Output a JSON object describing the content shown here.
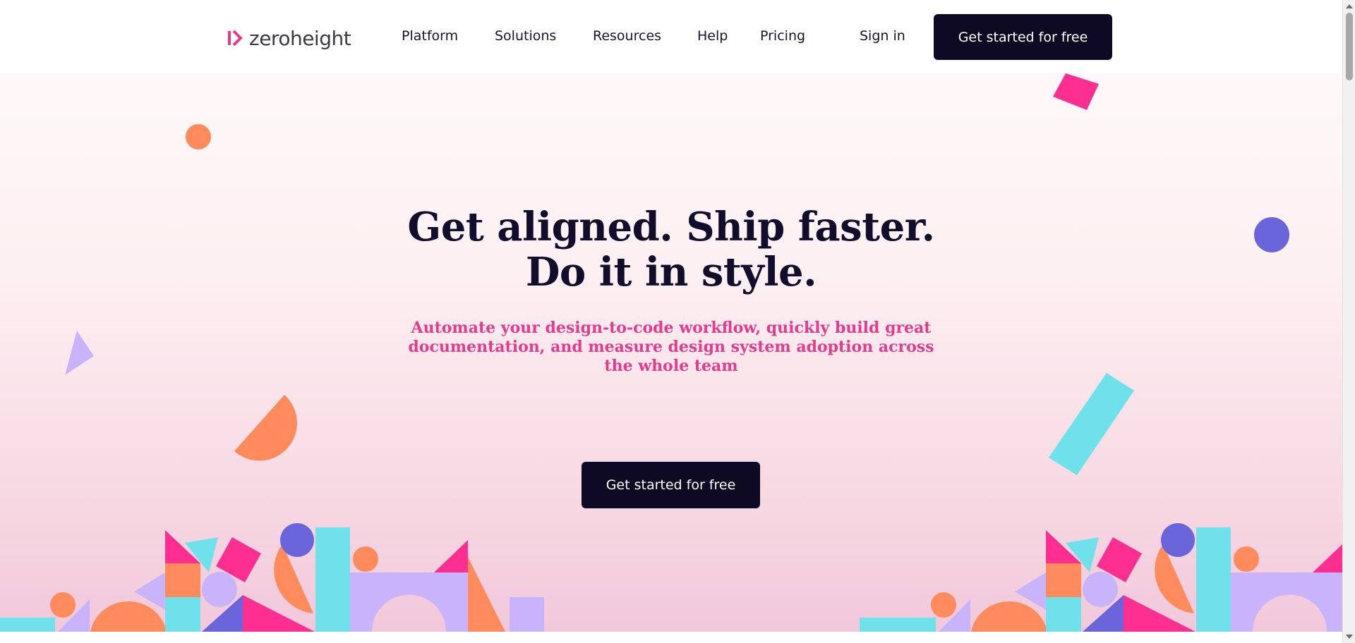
{
  "brand": {
    "name": "zeroheight",
    "logo_icon": "zeroheight-chevron-icon",
    "accent": "#e63b8c",
    "dark": "#0e0a24"
  },
  "nav": {
    "items": [
      {
        "label": "Platform"
      },
      {
        "label": "Solutions"
      },
      {
        "label": "Resources"
      },
      {
        "label": "Help"
      },
      {
        "label": "Pricing"
      }
    ],
    "sign_in": "Sign in",
    "cta": "Get started for free"
  },
  "hero": {
    "title_line1": "Get aligned. Ship faster.",
    "title_line2": "Do it in style.",
    "subtitle": "Automate your design-to-code workflow, quickly build great documentation, and measure design system adoption across the whole team",
    "cta": "Get started for free"
  },
  "palette": {
    "coral": "#ff8a5c",
    "pink": "#ff2e91",
    "cyan": "#6ee1ea",
    "lavender": "#c9b4fb",
    "indigo": "#6b65dc"
  }
}
